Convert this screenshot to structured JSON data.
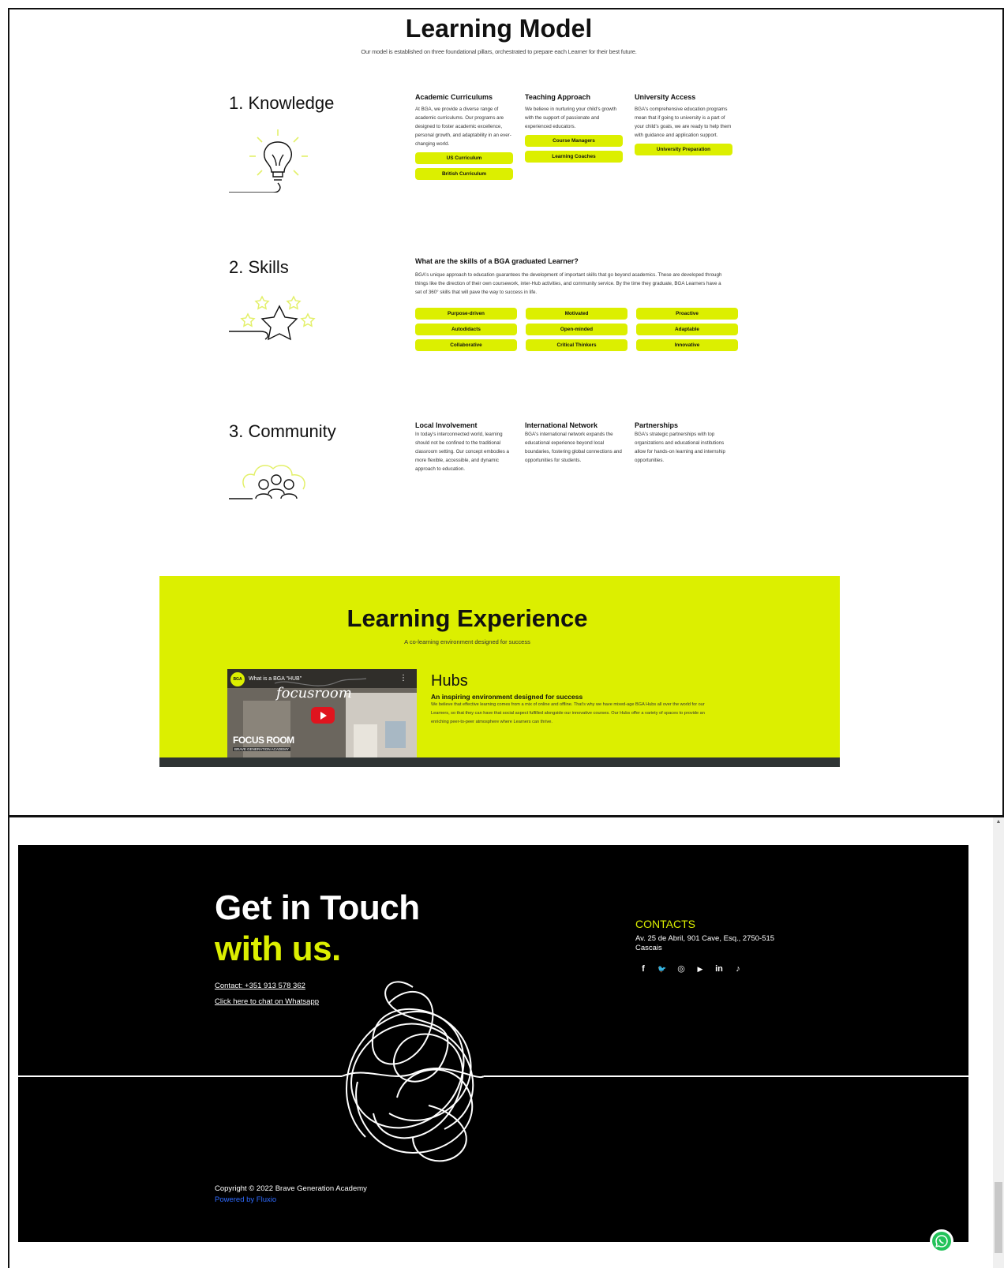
{
  "learning_model": {
    "title": "Learning Model",
    "subtitle": "Our model is established on three foundational pillars, orchestrated to prepare each Learner for their best future."
  },
  "knowledge": {
    "title": "1. Knowledge",
    "icon": "lightbulb-icon",
    "columns": [
      {
        "title": "Academic Curriculums",
        "text": "At BGA, we provide a diverse range of academic curriculums. Our programs are designed to foster academic excellence, personal growth, and adaptability in an ever-changing world.",
        "buttons": [
          "US Curriculum",
          "British Curriculum"
        ]
      },
      {
        "title": "Teaching Approach",
        "text": "We believe in nurturing your child's growth with the support of passionate and experienced educators.",
        "buttons": [
          "Course Managers",
          "Learning Coaches"
        ]
      },
      {
        "title": "University Access",
        "text": "BGA's comprehensive education programs mean that if going to university is a part of your child's goals, we are ready to help them with guidance and application support.",
        "buttons": [
          "University Preparation"
        ]
      }
    ]
  },
  "skills": {
    "title": "2. Skills",
    "icon": "star-icon",
    "heading": "What are the skills of a BGA graduated Learner?",
    "text": "BGA's unique approach to education guarantees the development of important skills that go beyond academics. These are developed through things like the direction of their own coursework, inter-Hub activities, and community service. By the time they graduate, BGA Learners have a set of 360° skills that will pave the way to success in life.",
    "items": [
      "Purpose-driven",
      "Motivated",
      "Proactive",
      "Autodidacts",
      "Open-minded",
      "Adaptable",
      "Collaborative",
      "Critical Thinkers",
      "Innovative"
    ]
  },
  "community": {
    "title": "3. Community",
    "icon": "people-icon",
    "columns": [
      {
        "title": "Local Involvement",
        "text": "In today's interconnected world, learning should not be confined to the traditional classroom setting. Our concept embodies a more flexible, accessible, and dynamic approach to education."
      },
      {
        "title": "International Network",
        "text": "BGA's international network expands the educational experience beyond local boundaries, fostering global connections and opportunities for students."
      },
      {
        "title": "Partnerships",
        "text": "BGA's strategic partnerships with top organizations and educational institutions allow for hands-on learning and internship opportunities."
      }
    ]
  },
  "learning_experience": {
    "title": "Learning Experience",
    "subtitle": "A co-learning environment designed for success",
    "video": {
      "title": "What is a BGA \"HUB\"",
      "logo": "BGA",
      "overlay_script": "focusroom",
      "caption": "FOCUS ROOM",
      "caption_small": "BRAVE GENERATION ACADEMY"
    },
    "hubs_title": "Hubs",
    "hubs_subtitle": "An inspiring environment designed for success",
    "hubs_text": "We believe that effective learning comes from a mix of online and offline. That's why we have mixed-age BGA Hubs all over the world for our Learners, so that they can have that social aspect fulfilled alongside our innovative courses. Our Hubs offer a variety of spaces to provide an enriching peer-to-peer atmosphere where Learners can thrive."
  },
  "footer": {
    "heading_line1": "Get in Touch",
    "heading_line2": "with us.",
    "contact_phone": "Contact: +351 913 578 362",
    "whatsapp_link": "Click here to chat on Whatsapp",
    "contacts_title": "CONTACTS",
    "address": "Av. 25 de Abril, 901 Cave, Esq., 2750-515 Cascais",
    "socials": [
      {
        "name": "facebook-icon",
        "glyph": "f"
      },
      {
        "name": "twitter-icon",
        "glyph": "🐦"
      },
      {
        "name": "instagram-icon",
        "glyph": "◎"
      },
      {
        "name": "youtube-icon",
        "glyph": "▶"
      },
      {
        "name": "linkedin-icon",
        "glyph": "in"
      },
      {
        "name": "tiktok-icon",
        "glyph": "♪"
      }
    ],
    "copyright": "Copyright © 2022 Brave Generation Academy",
    "powered_by": "Powered by Fluxio"
  },
  "colors": {
    "accent": "#dcef00",
    "footer_bg": "#000000",
    "link_blue": "#2f6bff",
    "whatsapp_green": "#23c35a"
  }
}
